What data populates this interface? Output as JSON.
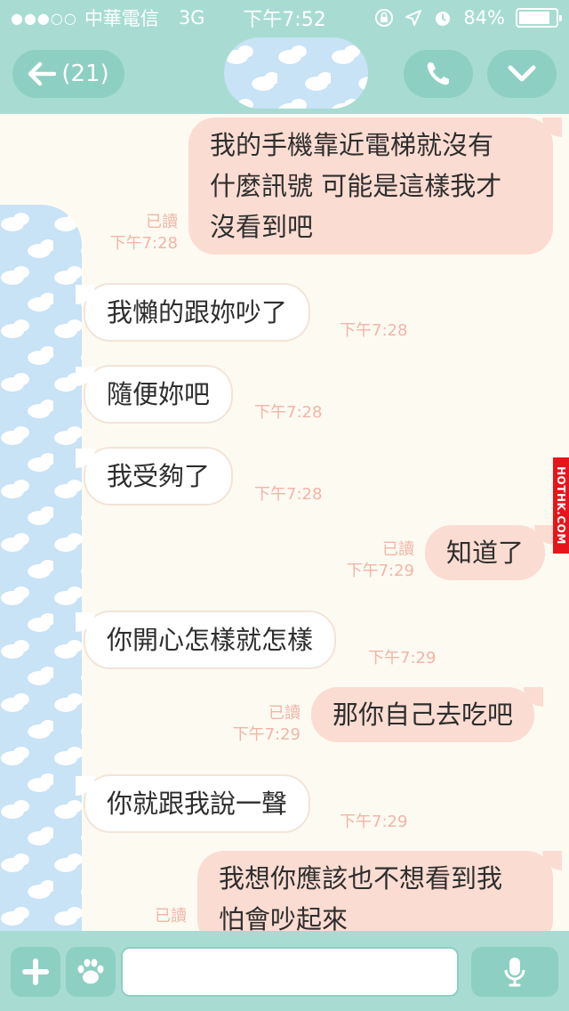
{
  "status_bar": {
    "signal_dots": "●●●○○",
    "carrier": "中華電信",
    "network": "3G",
    "time": "下午7:52",
    "battery_percent": "84%",
    "battery_level": 0.84
  },
  "header": {
    "back_label": "(21)"
  },
  "messages": [
    {
      "side": "out",
      "lines": [
        "我的手機靠近電梯就沒有",
        "什麼訊號 可能是這樣我才",
        "沒看到吧"
      ],
      "read": "已讀",
      "time": "下午7:28"
    },
    {
      "side": "in",
      "lines": [
        "我懶的跟妳吵了"
      ],
      "time": "下午7:28"
    },
    {
      "side": "in",
      "lines": [
        "隨便妳吧"
      ],
      "time": "下午7:28"
    },
    {
      "side": "in",
      "lines": [
        "我受夠了"
      ],
      "time": "下午7:28"
    },
    {
      "side": "out",
      "lines": [
        "知道了"
      ],
      "read": "已讀",
      "time": "下午7:29"
    },
    {
      "side": "in",
      "lines": [
        "你開心怎樣就怎樣"
      ],
      "time": "下午7:29"
    },
    {
      "side": "out",
      "lines": [
        "那你自己去吃吧"
      ],
      "read": "已讀",
      "time": "下午7:29"
    },
    {
      "side": "in",
      "lines": [
        "你就跟我說一聲"
      ],
      "time": "下午7:29"
    },
    {
      "side": "out",
      "lines": [
        "我想你應該也不想看到我",
        "怕會吵起來"
      ],
      "read": "已讀",
      "time": ""
    }
  ],
  "watermark": "HOTHK.COM",
  "input": {
    "placeholder": ""
  },
  "colors": {
    "header": "#a8dcd2",
    "button": "#8dcfc3",
    "outgoing_bubble": "#fbdcd2",
    "incoming_bubble": "#ffffff",
    "meta_text": "#f3b4a8",
    "chat_background": "#fdfbf1"
  },
  "icons": {
    "back": "back-arrow-icon",
    "call": "phone-icon",
    "menu": "chevron-down-icon",
    "plus": "plus-icon",
    "sticker": "paw-icon",
    "mic": "microphone-icon"
  }
}
